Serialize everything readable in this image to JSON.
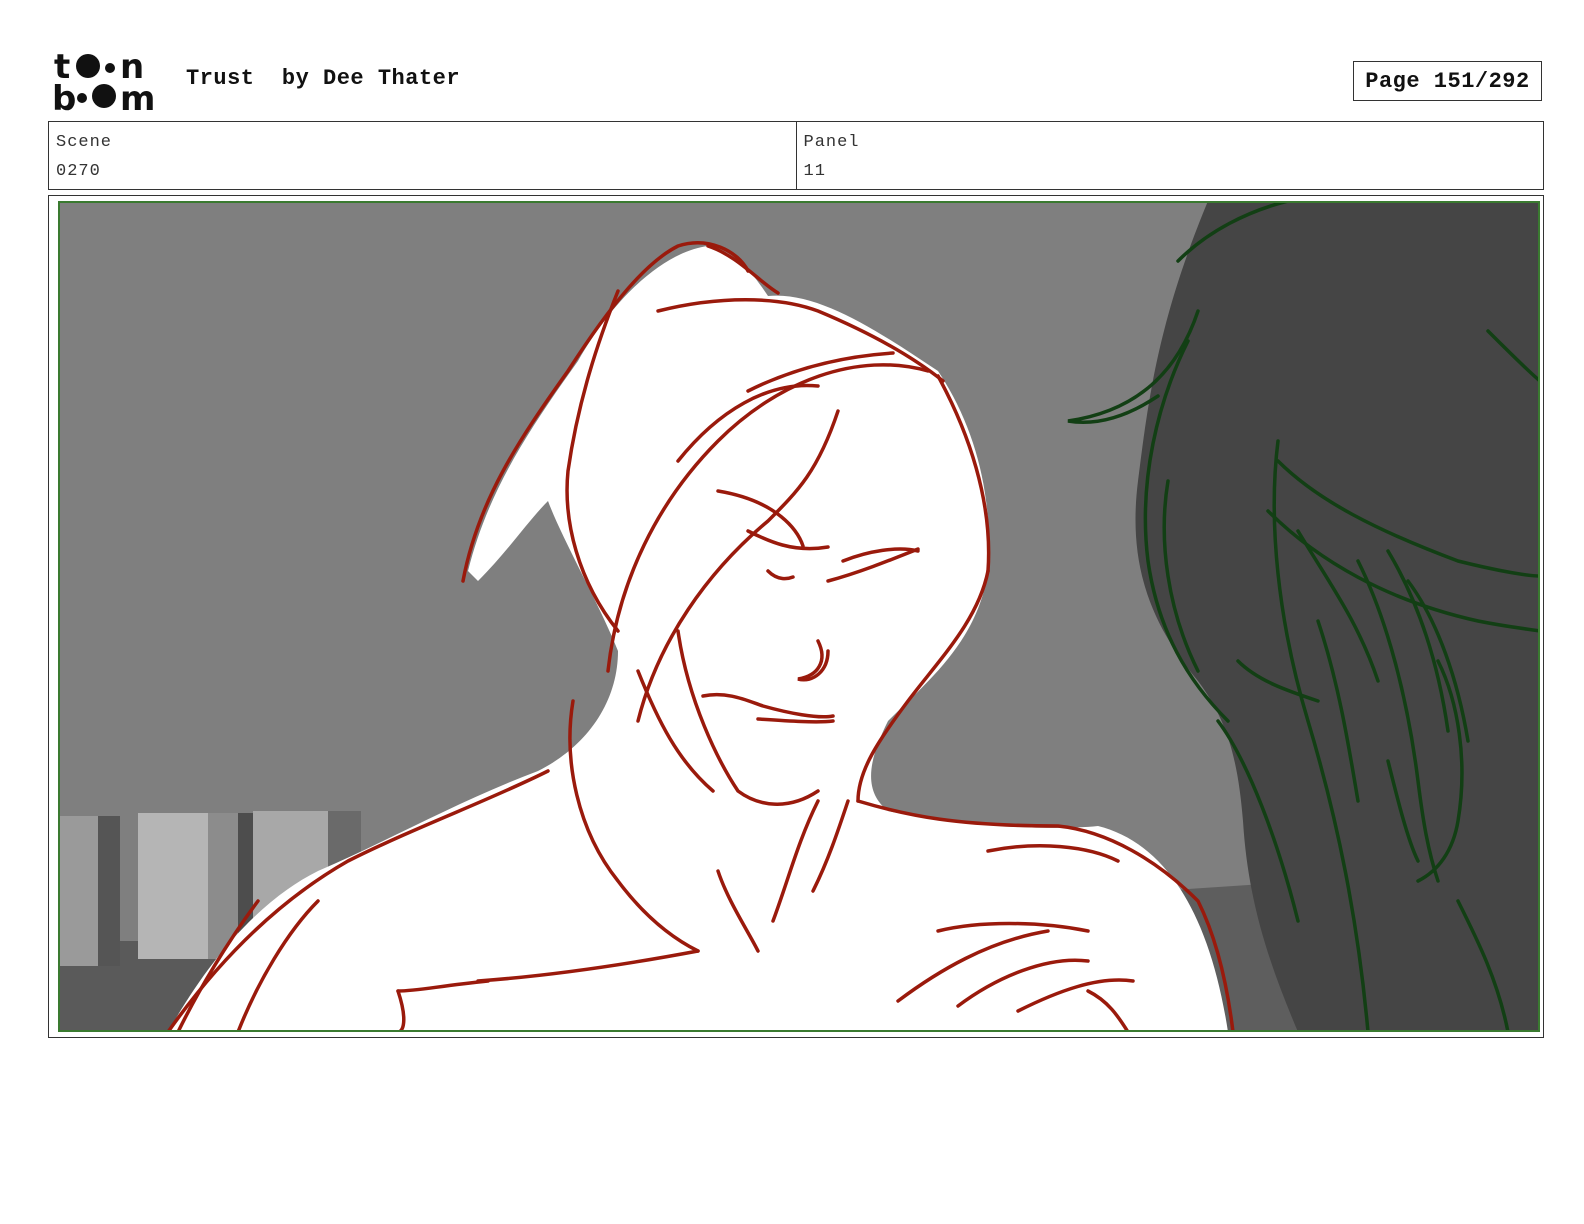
{
  "logo": {
    "line1": "toon",
    "line2": "boom"
  },
  "header": {
    "title": "Trust",
    "author": "by Dee Thater",
    "page": "Page 151/292"
  },
  "info": {
    "scene_label": "Scene",
    "scene_value": "0270",
    "panel_label": "Panel",
    "panel_value": "11"
  },
  "colors": {
    "sketch_red": "#9a1a0c",
    "sketch_green": "#123f14",
    "background_gray": "#7f7f7f",
    "frame_green": "#3a7a30"
  }
}
